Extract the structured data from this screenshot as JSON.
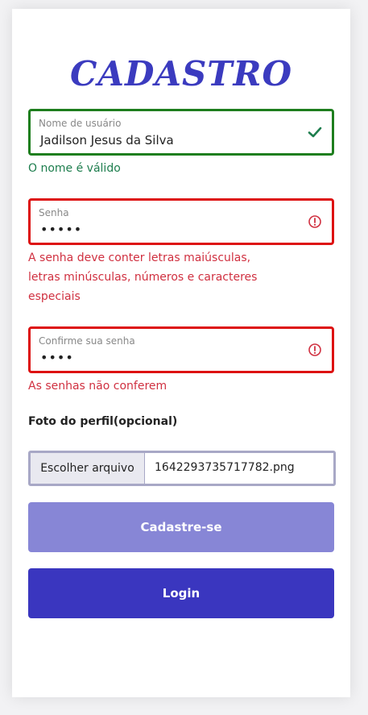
{
  "page": {
    "title": "CADASTRO"
  },
  "username": {
    "label": "Nome de usuário",
    "value": "Jadilson Jesus da Silva",
    "status_icon": "check-icon",
    "message": "O nome é válido"
  },
  "password": {
    "label": "Senha",
    "value": "•••••",
    "status_icon": "alert-circle-icon",
    "message_lines": [
      "A senha deve conter letras maiúsculas,",
      "letras minúsculas, números e caracteres",
      "especiais"
    ]
  },
  "confirm_password": {
    "label": "Confirme sua senha",
    "value": "••••",
    "status_icon": "alert-circle-icon",
    "message": "As senhas não conferem"
  },
  "profile_photo": {
    "label": "Foto do perfil(opcional)",
    "button_label": "Escolher arquivo",
    "file_name": "1642293735717782.png"
  },
  "actions": {
    "register_label": "Cadastre-se",
    "login_label": "Login"
  },
  "colors": {
    "title": "#3b3bbf",
    "valid": "#1e7e1e",
    "invalid": "#dd1111",
    "register_button": "#8786d6",
    "login_button": "#3a36bf"
  }
}
